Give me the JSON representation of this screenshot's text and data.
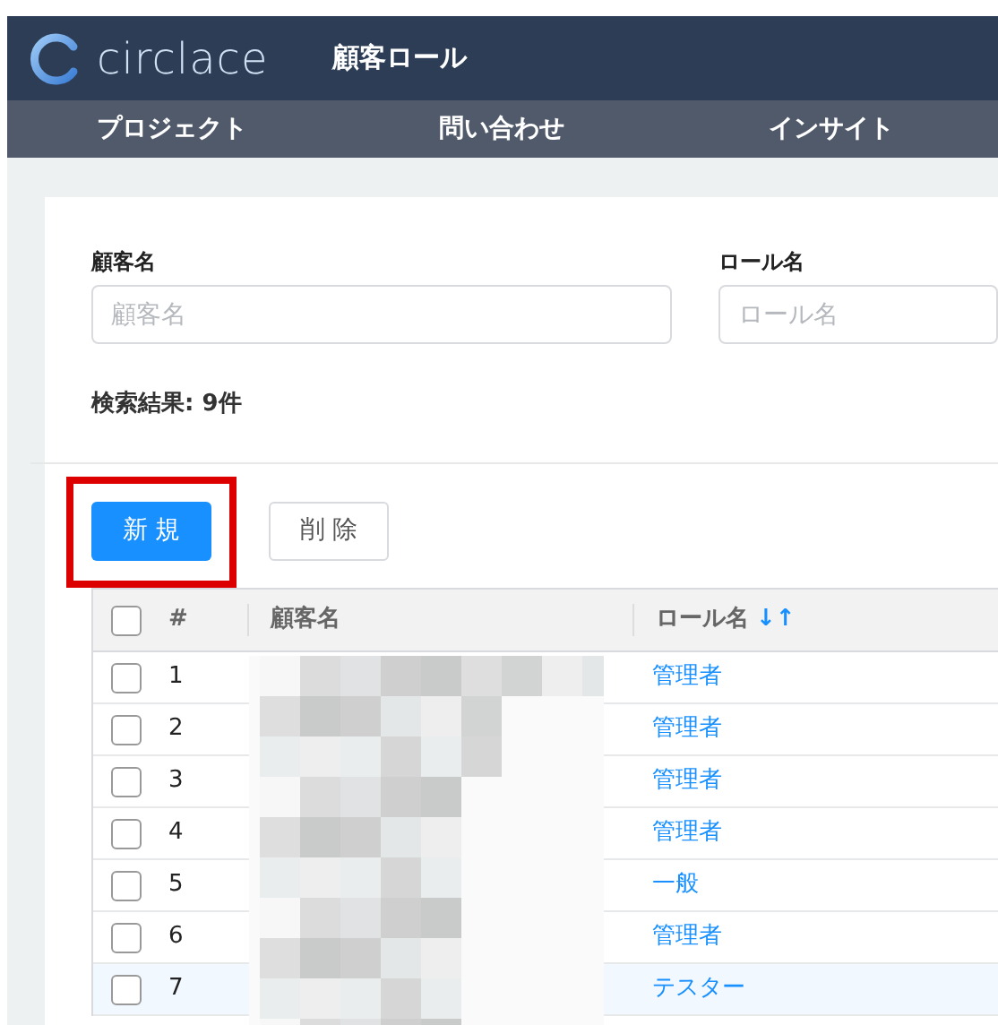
{
  "header": {
    "logo_text": "circlace",
    "page_title": "顧客ロール"
  },
  "nav": [
    {
      "label": "プロジェクト"
    },
    {
      "label": "問い合わせ"
    },
    {
      "label": "インサイト"
    }
  ],
  "search": {
    "fields": [
      {
        "label": "顧客名",
        "placeholder": "顧客名"
      },
      {
        "label": "ロール名",
        "placeholder": "ロール名"
      }
    ],
    "result": "検索結果: 9件"
  },
  "buttons": [
    {
      "label": "新 規",
      "kind": "primary",
      "highlighted": true
    },
    {
      "label": "削 除",
      "kind": "secondary",
      "highlighted": false
    }
  ],
  "table": {
    "columns": [
      {
        "label": "#"
      },
      {
        "label": "顧客名"
      },
      {
        "label": "ロール名",
        "sort": "↓↑"
      }
    ],
    "header_checked": false,
    "rows": [
      {
        "no": "1",
        "role": "管理者",
        "checked": false,
        "hovered": false
      },
      {
        "no": "2",
        "role": "管理者",
        "checked": false,
        "hovered": false
      },
      {
        "no": "3",
        "role": "管理者",
        "checked": false,
        "hovered": false
      },
      {
        "no": "4",
        "role": "管理者",
        "checked": false,
        "hovered": false
      },
      {
        "no": "5",
        "role": "一般",
        "checked": false,
        "hovered": false
      },
      {
        "no": "6",
        "role": "管理者",
        "checked": false,
        "hovered": false
      },
      {
        "no": "7",
        "role": "テスター",
        "checked": false,
        "hovered": true
      }
    ]
  }
}
